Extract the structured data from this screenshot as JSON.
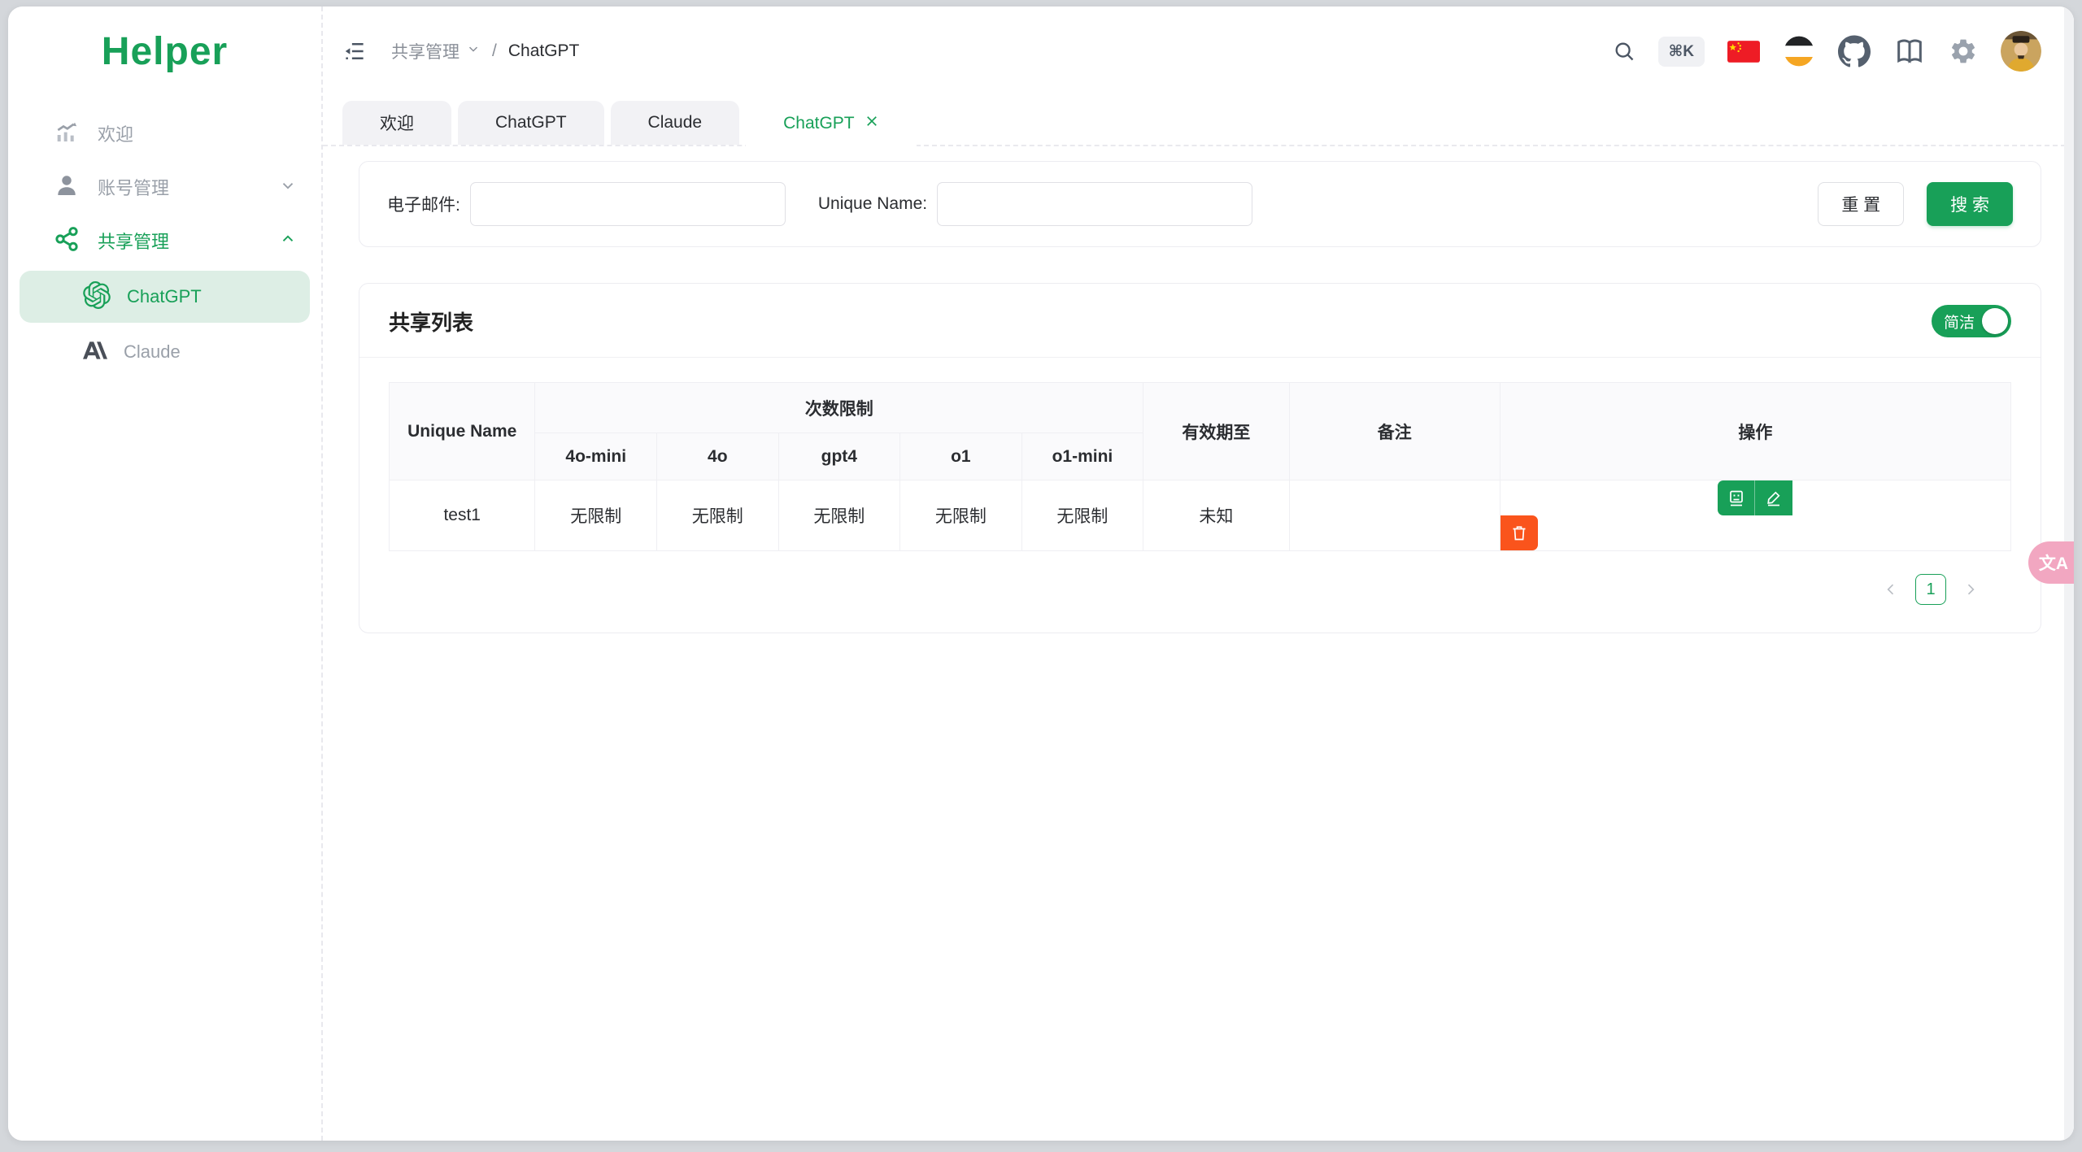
{
  "app": {
    "logo": "Helper"
  },
  "colors": {
    "primary": "#18a058",
    "danger": "#fa541c",
    "pink": "#f2a7c1",
    "selected_bg": "#ddeee5"
  },
  "sidebar": {
    "items": [
      {
        "label": "欢迎"
      },
      {
        "label": "账号管理"
      },
      {
        "label": "共享管理"
      }
    ],
    "subitems": [
      {
        "label": "ChatGPT"
      },
      {
        "label": "Claude"
      }
    ]
  },
  "header": {
    "breadcrumb_parent": "共享管理",
    "breadcrumb_separator": "/",
    "breadcrumb_current": "ChatGPT",
    "shortcut_badge": "⌘K"
  },
  "tabs": [
    {
      "label": "欢迎"
    },
    {
      "label": "ChatGPT"
    },
    {
      "label": "Claude"
    },
    {
      "label": "ChatGPT"
    }
  ],
  "filter": {
    "email_label": "电子邮件:",
    "email_value": "",
    "unique_label": "Unique Name:",
    "unique_value": "",
    "reset_label": "重 置",
    "search_label": "搜 索"
  },
  "list": {
    "title": "共享列表",
    "toggle_label": "简洁"
  },
  "table": {
    "col_unique": "Unique Name",
    "col_limit_group": "次数限制",
    "col_models": [
      "4o-mini",
      "4o",
      "gpt4",
      "o1",
      "o1-mini"
    ],
    "col_expire": "有效期至",
    "col_note": "备注",
    "col_actions": "操作",
    "rows": [
      {
        "unique": "test1",
        "limits": [
          "无限制",
          "无限制",
          "无限制",
          "无限制",
          "无限制"
        ],
        "expire": "未知",
        "note": ""
      }
    ]
  },
  "pagination": {
    "page": "1"
  },
  "float_button": {
    "label": "文A"
  }
}
